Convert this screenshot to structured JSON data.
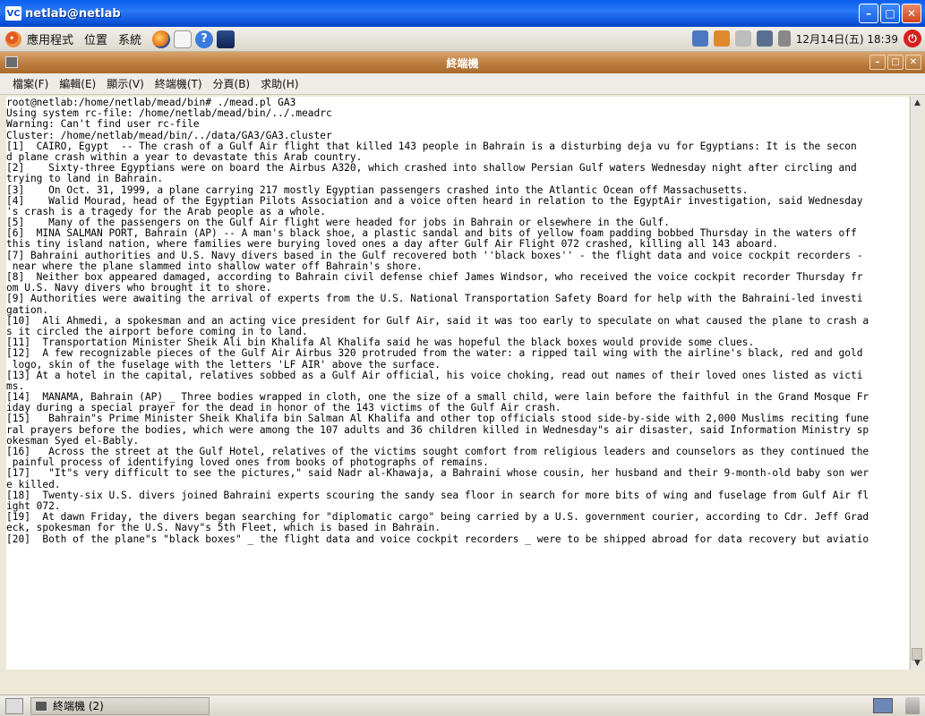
{
  "window": {
    "title": "netlab@netlab",
    "app_badge": "VC"
  },
  "panel": {
    "menus": [
      "應用程式",
      "位置",
      "系統"
    ],
    "clock": "12月14日(五) 18:39"
  },
  "terminal": {
    "title": "終端機",
    "menus": [
      "檔案(F)",
      "編輯(E)",
      "顯示(V)",
      "終端機(T)",
      "分頁(B)",
      "求助(H)"
    ],
    "lines": [
      "root@netlab:/home/netlab/mead/bin# ./mead.pl GA3",
      "Using system rc-file: /home/netlab/mead/bin/../.meadrc",
      "Warning: Can't find user rc-file",
      "Cluster: /home/netlab/mead/bin/../data/GA3/GA3.cluster",
      "[1]  CAIRO, Egypt  -- The crash of a Gulf Air flight that killed 143 people in Bahrain is a disturbing deja vu for Egyptians: It is the secon",
      "d plane crash within a year to devastate this Arab country.",
      "[2]    Sixty-three Egyptians were on board the Airbus A320, which crashed into shallow Persian Gulf waters Wednesday night after circling and",
      "trying to land in Bahrain.",
      "[3]    On Oct. 31, 1999, a plane carrying 217 mostly Egyptian passengers crashed into the Atlantic Ocean off Massachusetts.",
      "[4]    Walid Mourad, head of the Egyptian Pilots Association and a voice often heard in relation to the EgyptAir investigation, said Wednesday",
      "'s crash is a tragedy for the Arab people as a whole.",
      "[5]    Many of the passengers on the Gulf Air flight were headed for jobs in Bahrain or elsewhere in the Gulf.",
      "[6]  MINA SALMAN PORT, Bahrain (AP) -- A man's black shoe, a plastic sandal and bits of yellow foam padding bobbed Thursday in the waters off",
      "this tiny island nation, where families were burying loved ones a day after Gulf Air Flight 072 crashed, killing all 143 aboard.",
      "[7] Bahraini authorities and U.S. Navy divers based in the Gulf recovered both ''black boxes'' - the flight data and voice cockpit recorders -",
      " near where the plane slammed into shallow water off Bahrain's shore.",
      "[8]  Neither box appeared damaged, according to Bahrain civil defense chief James Windsor, who received the voice cockpit recorder Thursday fr",
      "om U.S. Navy divers who brought it to shore.",
      "[9] Authorities were awaiting the arrival of experts from the U.S. National Transportation Safety Board for help with the Bahraini-led investi",
      "gation.",
      "[10]  Ali Ahmedi, a spokesman and an acting vice president for Gulf Air, said it was too early to speculate on what caused the plane to crash a",
      "s it circled the airport before coming in to land.",
      "[11]  Transportation Minister Sheik Ali bin Khalifa Al Khalifa said he was hopeful the black boxes would provide some clues.",
      "[12]  A few recognizable pieces of the Gulf Air Airbus 320 protruded from the water: a ripped tail wing with the airline's black, red and gold",
      " logo, skin of the fuselage with the letters 'LF AIR' above the surface.",
      "[13] At a hotel in the capital, relatives sobbed as a Gulf Air official, his voice choking, read out names of their loved ones listed as victi",
      "ms.",
      "[14]  MANAMA, Bahrain (AP) _ Three bodies wrapped in cloth, one the size of a small child, were lain before the faithful in the Grand Mosque Fr",
      "iday during a special prayer for the dead in honor of the 143 victims of the Gulf Air crash.",
      "[15]   Bahrain\"s Prime Minister Sheik Khalifa bin Salman Al Khalifa and other top officials stood side-by-side with 2,000 Muslims reciting fune",
      "ral prayers before the bodies, which were among the 107 adults and 36 children killed in Wednesday\"s air disaster, said Information Ministry sp",
      "okesman Syed el-Bably.",
      "[16]   Across the street at the Gulf Hotel, relatives of the victims sought comfort from religious leaders and counselors as they continued the",
      " painful process of identifying loved ones from books of photographs of remains.",
      "[17]   \"It\"s very difficult to see the pictures,\" said Nadr al-Khawaja, a Bahraini whose cousin, her husband and their 9-month-old baby son wer",
      "e killed.",
      "[18]  Twenty-six U.S. divers joined Bahraini experts scouring the sandy sea floor in search for more bits of wing and fuselage from Gulf Air fl",
      "ight 072.",
      "[19]  At dawn Friday, the divers began searching for \"diplomatic cargo\" being carried by a U.S. government courier, according to Cdr. Jeff Grad",
      "eck, spokesman for the U.S. Navy\"s 5th Fleet, which is based in Bahrain.",
      "[20]  Both of the plane\"s \"black boxes\" _ the flight data and voice cockpit recorders _ were to be shipped abroad for data recovery but aviatio"
    ]
  },
  "taskbar": {
    "task_label": "終端機 (2)"
  }
}
